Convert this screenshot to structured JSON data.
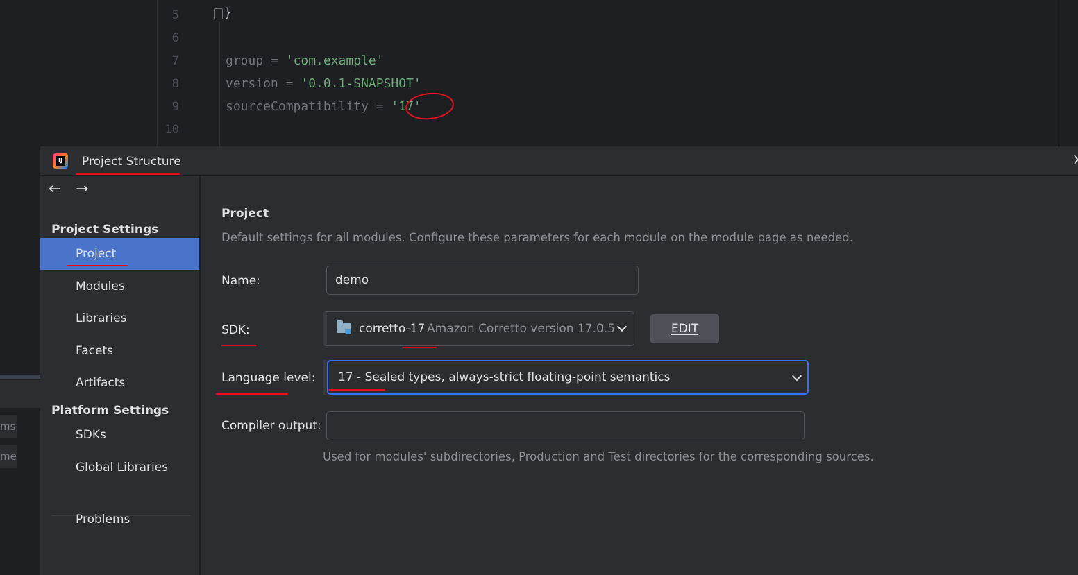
{
  "editor": {
    "lines": [
      {
        "num": "5",
        "text": "}"
      },
      {
        "num": "6",
        "text": ""
      },
      {
        "num": "7",
        "key": "group = ",
        "value": "'com.example'"
      },
      {
        "num": "8",
        "key": "version = ",
        "value": "'0.0.1-SNAPSHOT'"
      },
      {
        "num": "9",
        "key": "sourceCompatibility = ",
        "value": "'17'"
      },
      {
        "num": "10",
        "text": ""
      }
    ]
  },
  "background": {
    "chip1": "ms",
    "chip2": "mev"
  },
  "dialog": {
    "title": "Project Structure",
    "logo_text": "IJ",
    "close": "X",
    "nav": {
      "back": "←",
      "forward": "→"
    },
    "sidebar": {
      "project_settings": "Project Settings",
      "items": [
        "Project",
        "Modules",
        "Libraries",
        "Facets",
        "Artifacts"
      ],
      "platform_settings": "Platform Settings",
      "platform_items": [
        "SDKs",
        "Global Libraries"
      ],
      "problems": "Problems"
    },
    "content": {
      "title": "Project",
      "description": "Default settings for all modules. Configure these parameters for each module on the module page as needed.",
      "name_label": "Name:",
      "name_value": "demo",
      "sdk_label": "SDK:",
      "sdk_name": "corretto-17",
      "sdk_description": "Amazon Corretto version 17.0.5",
      "edit_button": "EDIT",
      "language_label": "Language level:",
      "language_value": "17 - Sealed types, always-strict floating-point semantics",
      "compiler_label": "Compiler output:",
      "compiler_value": "",
      "compiler_hint": "Used for modules' subdirectories, Production and Test directories for the corresponding sources."
    }
  },
  "colors": {
    "accent": "#3574f0",
    "selection": "#4a74c9",
    "annotation": "#e4101b",
    "string": "#6aab73"
  }
}
